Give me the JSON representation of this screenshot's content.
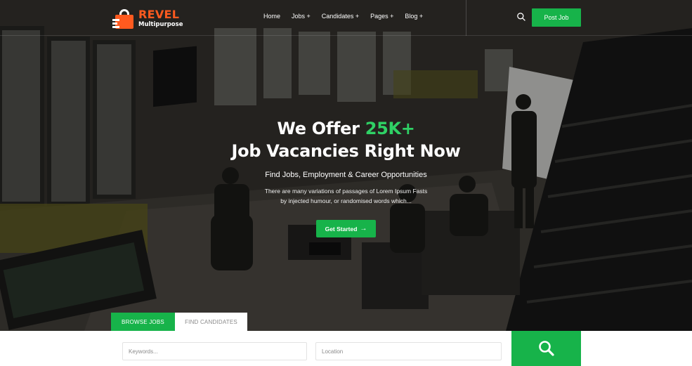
{
  "brand": {
    "name": "REVEL",
    "subtitle": "Multipurpose",
    "accent_color": "#ff5a1f",
    "primary_color": "#17b34a"
  },
  "nav": {
    "items": [
      {
        "label": "Home"
      },
      {
        "label": "Jobs +"
      },
      {
        "label": "Candidates +"
      },
      {
        "label": "Pages +"
      },
      {
        "label": "Blog +"
      }
    ],
    "search_icon": "search-icon",
    "post_job_label": "Post Job"
  },
  "hero": {
    "headline_prefix": "We Offer ",
    "headline_accent": "25K+",
    "headline_line2": "Job Vacancies Right Now",
    "tagline": "Find Jobs, Employment & Career Opportunities",
    "description_line1": "There are many variations of passages of Lorem Ipsum Fasts",
    "description_line2": "by injected humour, or randomised words which...",
    "cta_label": "Get Started",
    "cta_icon": "arrow-right-icon"
  },
  "search": {
    "tabs": [
      {
        "label": "BROWSE JOBS",
        "active": true
      },
      {
        "label": "FIND CANDIDATES",
        "active": false
      }
    ],
    "keywords_placeholder": "Keywords...",
    "location_placeholder": "Location",
    "submit_icon": "search-icon"
  }
}
